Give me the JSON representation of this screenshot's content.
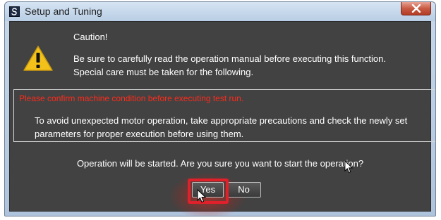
{
  "window": {
    "title": "Setup and Tuning",
    "close_icon": "close-x-icon",
    "app_icon": "app-icon"
  },
  "dialog": {
    "warning_icon": "warning-triangle-icon",
    "caution": "Caution!",
    "message_line1": "Be sure to carefully read the operation manual before executing this function.",
    "message_line2": "Special care must be taken for the following.",
    "notice_heading": "Please confirm machine condition before executing test run.",
    "notice_line1": "To avoid unexpected motor operation, take appropriate precautions and check the newly set",
    "notice_line2": "parameters for proper execution before using them.",
    "question": "Operation will be started. Are you sure you want to start the operation?"
  },
  "buttons": {
    "yes": "Yes",
    "no": "No"
  },
  "colors": {
    "dialog_background": "#424242",
    "notice_heading": "#ff2a1a",
    "highlight": "#e0202a",
    "warning_icon": "#f2c21b"
  }
}
